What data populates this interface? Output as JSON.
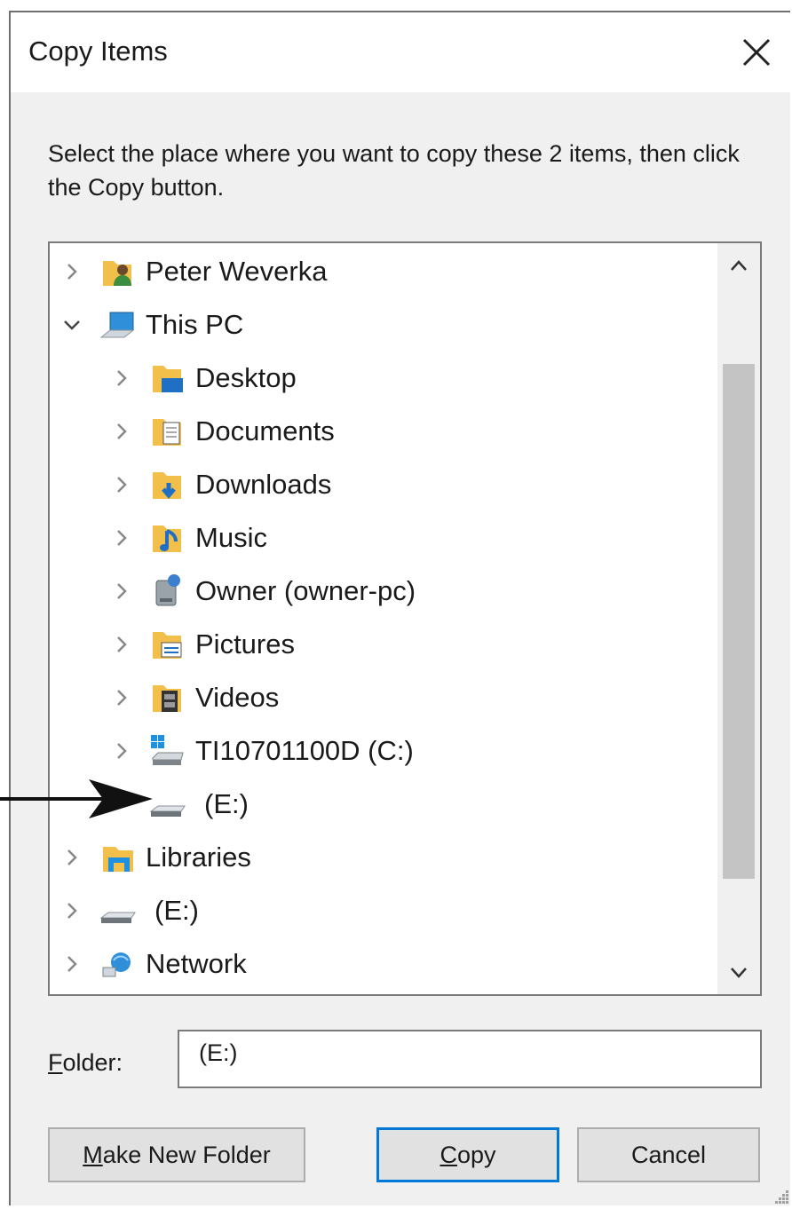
{
  "dialog": {
    "title": "Copy Items",
    "instruction": "Select the place where you want to copy these 2 items, then click the Copy button."
  },
  "tree": {
    "items": [
      {
        "label": "Peter Weverka",
        "icon": "user-folder-icon",
        "expanded": false,
        "level": 0
      },
      {
        "label": "This PC",
        "icon": "computer-icon",
        "expanded": true,
        "level": 0
      },
      {
        "label": "Desktop",
        "icon": "desktop-folder-icon",
        "expanded": false,
        "level": 1
      },
      {
        "label": "Documents",
        "icon": "documents-folder-icon",
        "expanded": false,
        "level": 1
      },
      {
        "label": "Downloads",
        "icon": "downloads-folder-icon",
        "expanded": false,
        "level": 1
      },
      {
        "label": "Music",
        "icon": "music-folder-icon",
        "expanded": false,
        "level": 1
      },
      {
        "label": "Owner (owner-pc)",
        "icon": "network-drive-icon",
        "expanded": false,
        "level": 1
      },
      {
        "label": "Pictures",
        "icon": "pictures-folder-icon",
        "expanded": false,
        "level": 1
      },
      {
        "label": "Videos",
        "icon": "videos-folder-icon",
        "expanded": false,
        "level": 1
      },
      {
        "label": "TI10701100D (C:)",
        "icon": "windows-drive-icon",
        "expanded": false,
        "level": 1
      },
      {
        "label": "(E:)",
        "icon": "removable-drive-icon",
        "expanded": null,
        "level": 1,
        "selected": true
      },
      {
        "label": "Libraries",
        "icon": "libraries-icon",
        "expanded": false,
        "level": 0
      },
      {
        "label": "(E:)",
        "icon": "removable-drive-icon",
        "expanded": false,
        "level": 0
      },
      {
        "label": "Network",
        "icon": "network-icon",
        "expanded": false,
        "level": 0
      }
    ]
  },
  "folder": {
    "label_access_key": "F",
    "label_rest": "older:",
    "value": "(E:)"
  },
  "buttons": {
    "make_new_folder_key": "M",
    "make_new_folder_rest": "ake New Folder",
    "copy_key": "C",
    "copy_rest": "opy",
    "cancel": "Cancel"
  },
  "colors": {
    "accent": "#0078d7",
    "selection": "#cce8ff",
    "dialog_bg": "#f0f0f0"
  }
}
